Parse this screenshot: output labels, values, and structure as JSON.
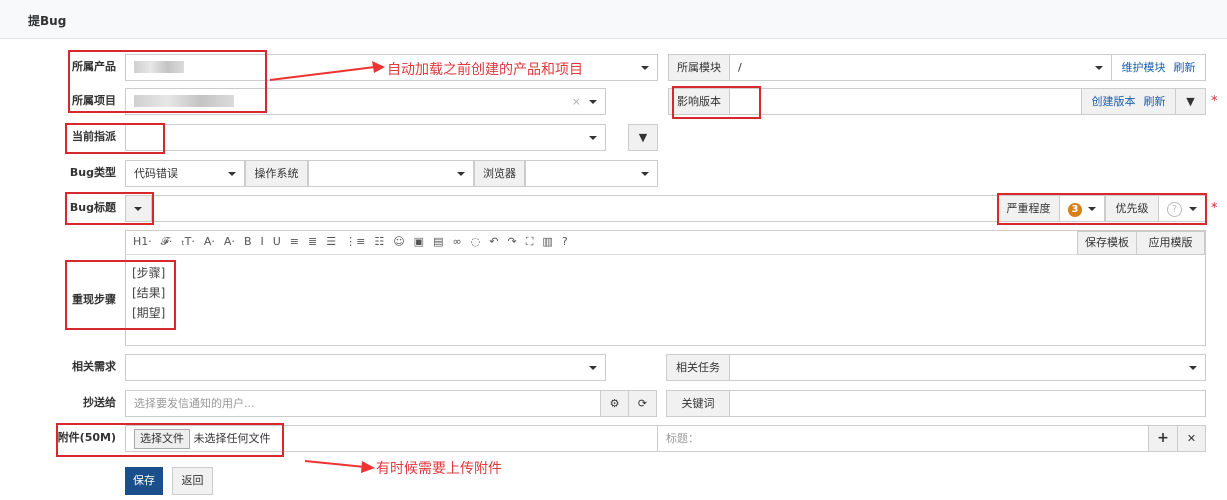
{
  "header": {
    "title": "提Bug"
  },
  "product": {
    "label": "所属产品"
  },
  "project": {
    "label": "所属项目",
    "clear": "×"
  },
  "module": {
    "label": "所属模块",
    "value": "/",
    "maintain": "维护模块",
    "refresh": "刷新"
  },
  "assign": {
    "label": "当前指派"
  },
  "build": {
    "label": "影响版本",
    "create": "创建版本",
    "refresh": "刷新"
  },
  "type": {
    "label": "Bug类型",
    "value": "代码错误",
    "os_label": "操作系统",
    "browser_label": "浏览器"
  },
  "title": {
    "label": "Bug标题",
    "severity_label": "严重程度",
    "severity": "3",
    "priority_label": "优先级",
    "priority": "?"
  },
  "editor": {
    "toolbar": [
      "H1·",
      "𝓕·",
      "ₜT·",
      "A·",
      "A·",
      "B",
      "I",
      "U",
      "≡",
      "≣",
      "☰",
      "⋮≡",
      "☷",
      "☺",
      "▣",
      "▤",
      "∞",
      "◌",
      "↶",
      "↷",
      "⛶",
      "▥",
      "?"
    ],
    "save_template": "保存模板",
    "apply_template": "应用模版",
    "label": "重现步骤",
    "lines": [
      "[步骤]",
      "[结果]",
      "[期望]"
    ]
  },
  "story": {
    "label": "相关需求"
  },
  "task": {
    "label": "相关任务"
  },
  "mailto": {
    "label": "抄送给",
    "placeholder": "选择要发信通知的用户..."
  },
  "keywords": {
    "label": "关键词"
  },
  "files": {
    "label": "附件(50M)",
    "choose": "选择文件",
    "none": "未选择任何文件",
    "title_placeholder": "标题：",
    "add": "+",
    "remove": "✕"
  },
  "actions": {
    "save": "保存",
    "back": "返回"
  },
  "annotations": {
    "top": "自动加载之前创建的产品和项目",
    "bottom": "有时候需要上传附件"
  },
  "required": "*"
}
